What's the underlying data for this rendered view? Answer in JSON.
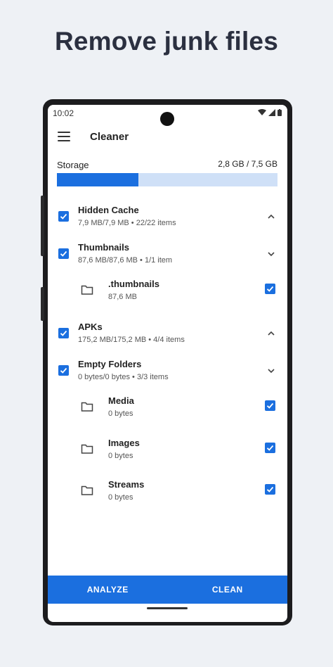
{
  "headline": "Remove junk files",
  "status": {
    "time": "10:02"
  },
  "toolbar": {
    "title": "Cleaner"
  },
  "storage": {
    "label": "Storage",
    "value": "2,8 GB / 7,5 GB",
    "used_fraction": 0.37
  },
  "groups": [
    {
      "title": "Hidden Cache",
      "subtitle": "7,9 MB/7,9 MB • 22/22 items",
      "expanded": false,
      "checked": true
    },
    {
      "title": "Thumbnails",
      "subtitle": "87,6 MB/87,6 MB • 1/1 item",
      "expanded": true,
      "checked": true,
      "children": [
        {
          "title": ".thumbnails",
          "subtitle": "87,6 MB",
          "checked": true
        }
      ]
    },
    {
      "title": "APKs",
      "subtitle": "175,2 MB/175,2 MB • 4/4 items",
      "expanded": false,
      "checked": true
    },
    {
      "title": "Empty Folders",
      "subtitle": "0 bytes/0 bytes • 3/3 items",
      "expanded": true,
      "checked": true,
      "children": [
        {
          "title": "Media",
          "subtitle": "0 bytes",
          "checked": true
        },
        {
          "title": "Images",
          "subtitle": "0 bytes",
          "checked": true
        },
        {
          "title": "Streams",
          "subtitle": "0 bytes",
          "checked": true
        }
      ]
    }
  ],
  "actions": {
    "analyze": "ANALYZE",
    "clean": "CLEAN"
  },
  "colors": {
    "accent": "#1b6fdf",
    "accent_light": "#cfe0f7",
    "background": "#eef1f5"
  }
}
